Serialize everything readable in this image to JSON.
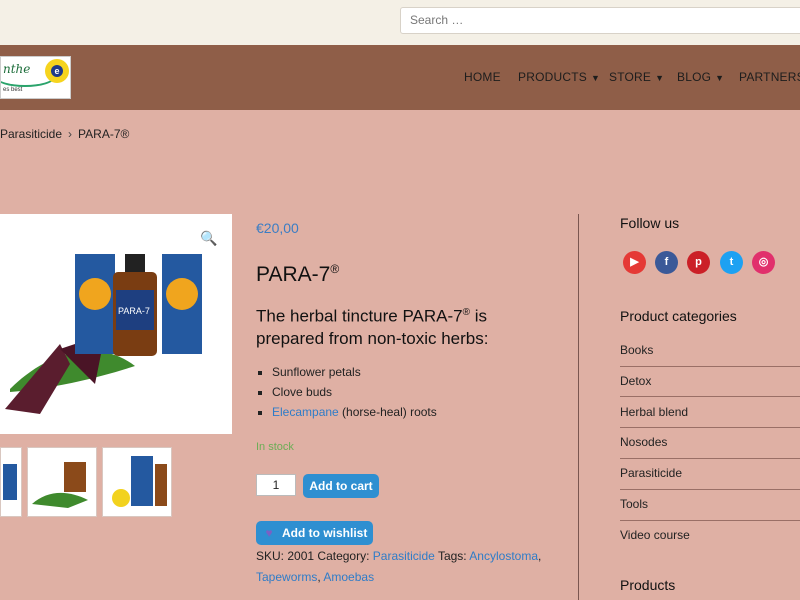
{
  "header": {
    "search_placeholder": "Search …",
    "logo_text": "nthe",
    "logo_letter": "e",
    "logo_tagline": "es best"
  },
  "nav": {
    "items": [
      {
        "label": "HOME"
      },
      {
        "label": "PRODUCTS"
      },
      {
        "label": "STORE"
      },
      {
        "label": "BLOG"
      },
      {
        "label": "PARTNERS"
      }
    ]
  },
  "breadcrumb": {
    "parent": "Parasiticide",
    "current": "PARA-7®"
  },
  "product": {
    "price": "€20,00",
    "title": "PARA-7",
    "title_mark": "®",
    "desc_prefix": "The herbal tincture PARA-7",
    "desc_mark": "®",
    "desc_suffix": " is prepared from non-toxic herbs:",
    "features": [
      "Sunflower petals",
      "Clove buds",
      "Elecampane",
      " (horse-heal) roots"
    ],
    "stock": "In stock",
    "quantity": "1",
    "add_to_cart": "Add to cart",
    "add_to_wishlist": "Add to wishlist",
    "sku_label": "SKU:",
    "sku": "2001",
    "category_label": "Category:",
    "category": "Parasiticide",
    "tags_label": "Tags:",
    "tags": [
      "Ancylostoma",
      "Tapeworms",
      "Amoebas"
    ],
    "bottle_label": "PARA-7"
  },
  "sidebar": {
    "follow_title": "Follow us",
    "categories_title": "Product categories",
    "categories": [
      "Books",
      "Detox",
      "Herbal blend",
      "Nosodes",
      "Parasiticide",
      "Tools",
      "Video course"
    ],
    "products_title": "Products"
  },
  "colors": {
    "accent": "#2e8fd1",
    "nav_bg": "#8f5e48",
    "page_bg": "#dfb0a4",
    "in_stock": "#6cad56"
  }
}
